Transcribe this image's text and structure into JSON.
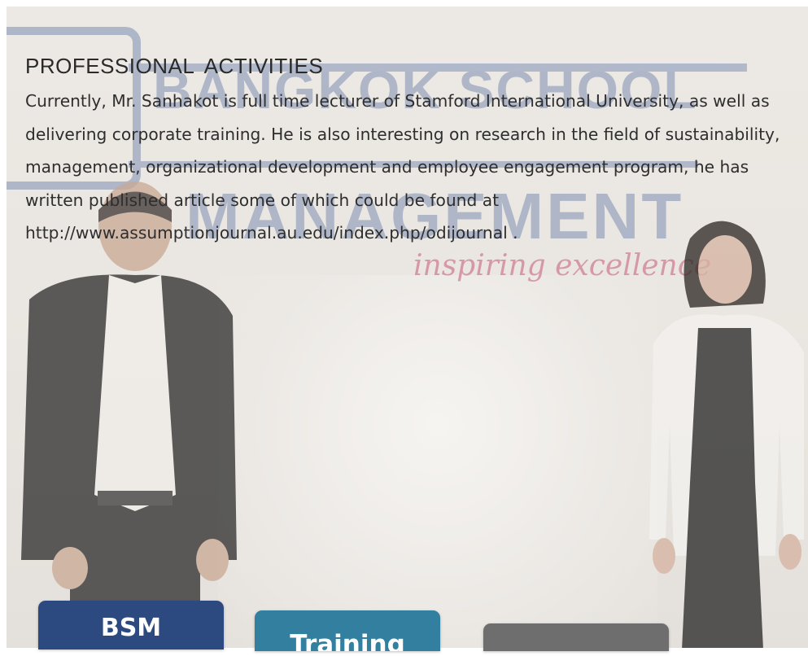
{
  "section": {
    "heading": "PROFESSIONAL  ACTIVITIES",
    "paragraph": "Currently, Mr. Sanhakot is full time lecturer of Stamford International University, as well as delivering corporate training. He is also interesting on research in the field of sustainability, management, organizational development and employee engagement program, he has written published article some of which could be found at http://www.assumptionjournal.au.edu/index.php/odijournal ."
  },
  "background": {
    "sign_line1": "BANGKOK SCHOOL",
    "sign_line2": "MANAGEMENT",
    "sign_tagline": "inspiring excellence"
  },
  "buttons": {
    "bsm_label": "BSM",
    "training_label": "Training",
    "third_label": ""
  },
  "colors": {
    "bsm": "#2d4a80",
    "training": "#337fa0",
    "grey": "#6e6e6e",
    "text": "#2e2e2e"
  }
}
